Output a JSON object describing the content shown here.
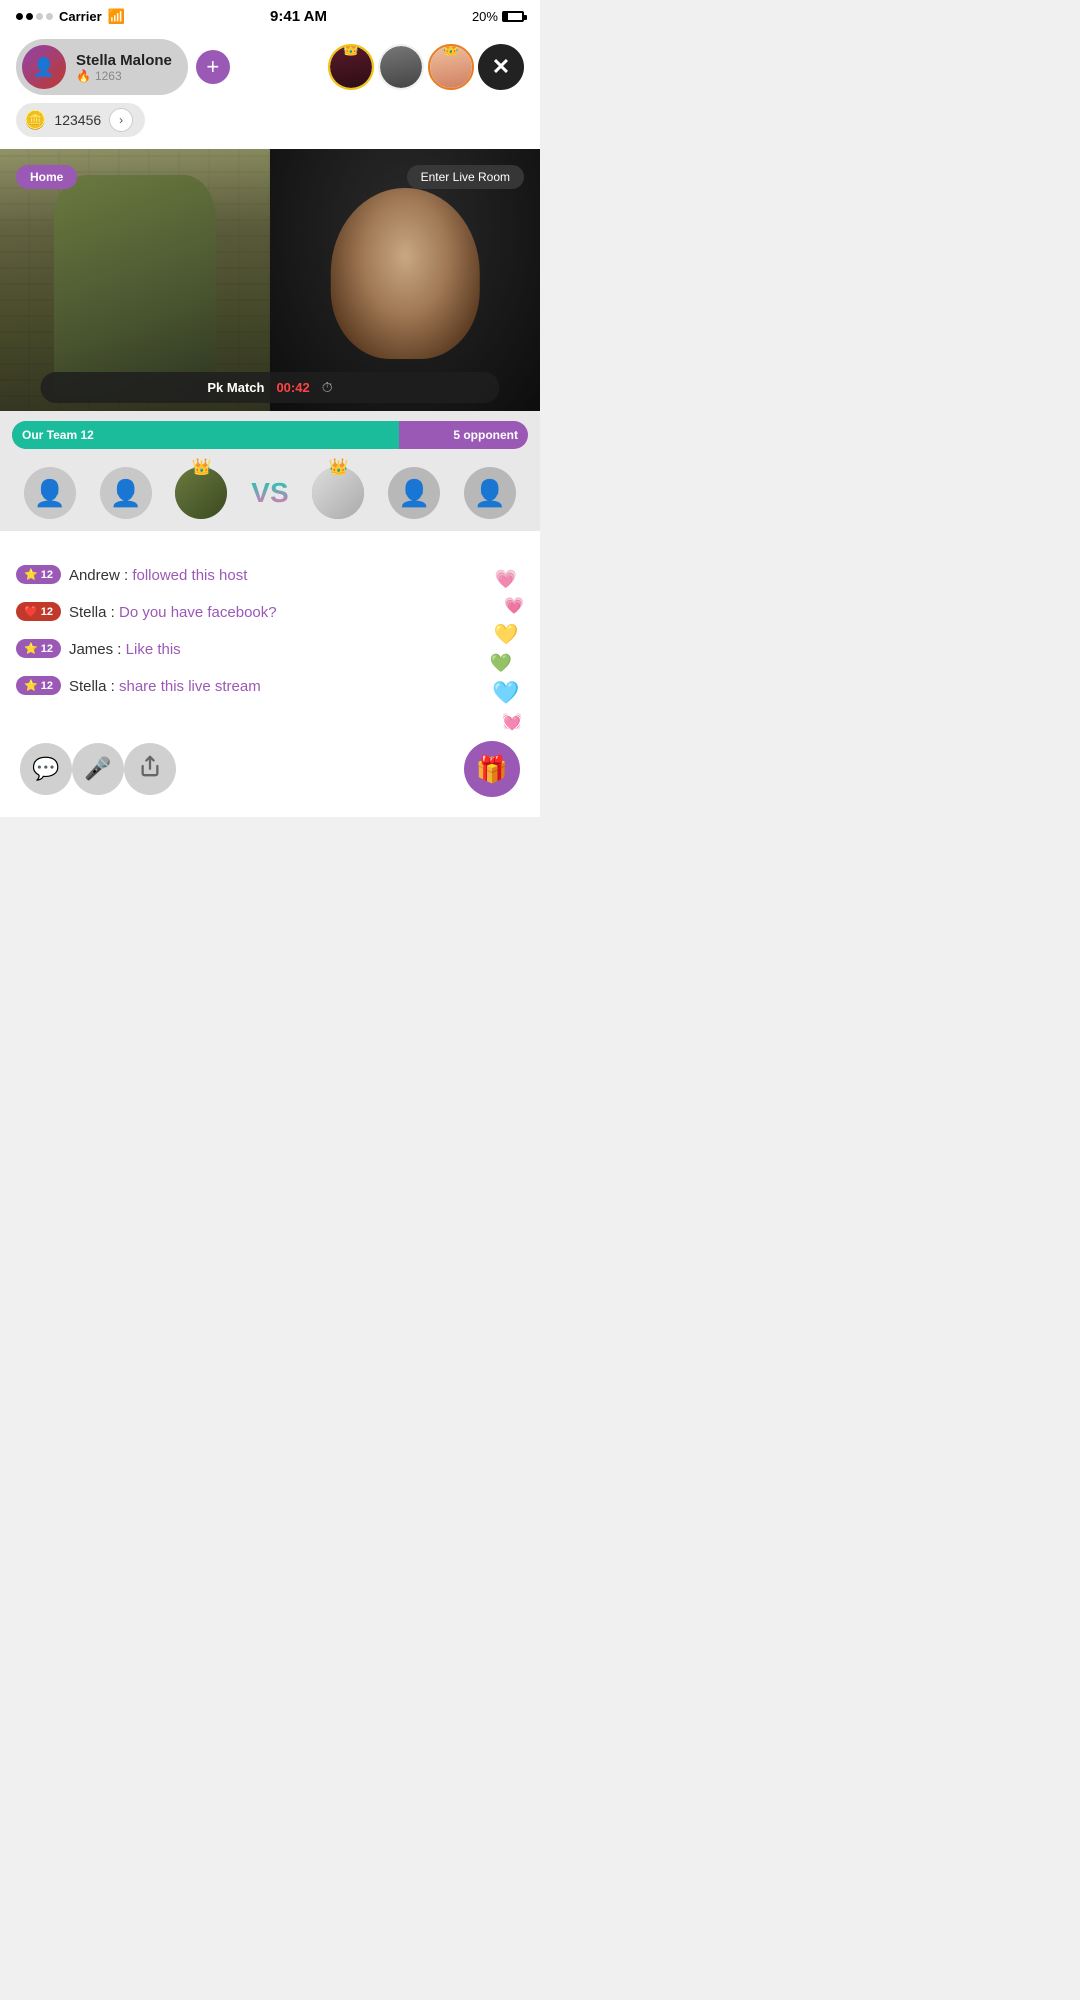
{
  "statusBar": {
    "carrier": "Carrier",
    "time": "9:41 AM",
    "battery": "20%"
  },
  "profile": {
    "name": "Stella Malone",
    "flames": "1263",
    "coins": "123456",
    "addBtn": "+",
    "arrowBtn": "›"
  },
  "miniAvatars": [
    {
      "id": 1,
      "crown": "gold",
      "crownChar": "👑"
    },
    {
      "id": 2,
      "crown": "none"
    },
    {
      "id": 3,
      "crown": "orange",
      "crownChar": "👑"
    }
  ],
  "video": {
    "homeBadge": "Home",
    "enterLiveRoom": "Enter Live Room",
    "pkLabel": "Pk Match",
    "pkTimer": "00:42"
  },
  "score": {
    "ourTeam": "Our Team 12",
    "opponent": "5 opponent",
    "ourPercent": 75
  },
  "chat": {
    "messages": [
      {
        "badgeType": "star",
        "badgeNum": "12",
        "username": "Andrew",
        "separator": " : ",
        "message": "followed this host"
      },
      {
        "badgeType": "heart",
        "badgeNum": "12",
        "username": "Stella",
        "separator": " : ",
        "message": "Do you have facebook?"
      },
      {
        "badgeType": "star",
        "badgeNum": "12",
        "username": "James",
        "separator": " : ",
        "message": "Like this"
      },
      {
        "badgeType": "star",
        "badgeNum": "12",
        "username": "Stella",
        "separator": " : ",
        "message": "share this live stream"
      }
    ]
  },
  "hearts": [
    "💗",
    "💛",
    "💚",
    "🩵",
    "💓",
    "💕"
  ],
  "toolbar": {
    "chatIcon": "💬",
    "micIcon": "🎤",
    "shareIcon": "↗",
    "giftIcon": "🎁"
  },
  "vsText": "VS"
}
